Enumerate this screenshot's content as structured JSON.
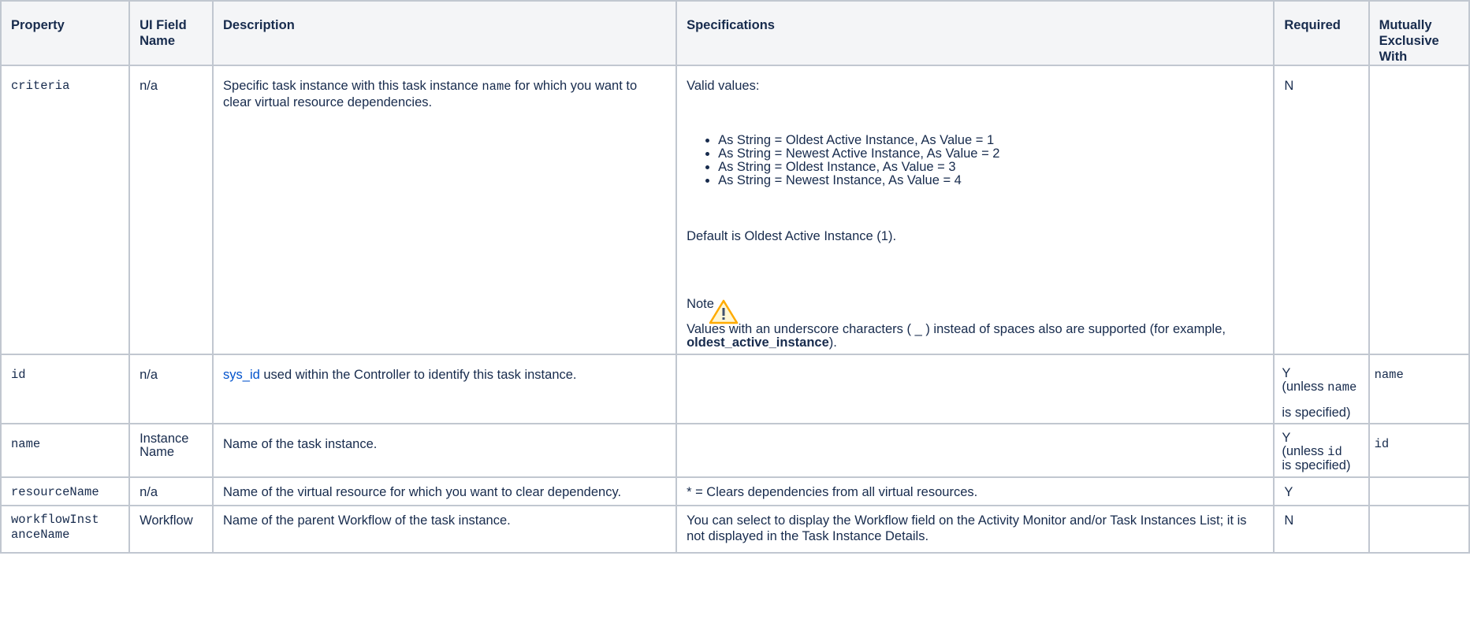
{
  "columns": [
    "Property",
    "UI Field Name",
    "Description",
    "Specifications",
    "Required",
    "Mutually Exclusive With"
  ],
  "rows": [
    {
      "property": "criteria",
      "ui_field": "n/a",
      "description_pre": "Specific task instance with this task instance ",
      "description_code": "name",
      "description_post": " for which you want to clear virtual resource dependencies.",
      "spec_intro": "Valid values:",
      "spec_items": [
        "As String = Oldest Active Instance, As Value = 1",
        "As String = Newest Active Instance, As Value = 2",
        "As String = Oldest Instance, As Value = 3",
        "As String = Newest Instance, As Value = 4"
      ],
      "spec_default": "Default is Oldest Active Instance (1).",
      "note_title": "Note",
      "note_pre": "Values with an underscore characters ( _ ) instead of spaces also are supported (for example, ",
      "note_bold": "oldest_active_instance",
      "note_post": ").",
      "required": "N",
      "exclusive": ""
    },
    {
      "property": "id",
      "ui_field": "n/a",
      "description_link": "sys_id",
      "description_post": " used within the Controller to identify this task instance.",
      "spec": "",
      "required_line1": "Y",
      "required_pre": "(unless ",
      "required_code": "name",
      "required_post": "is specified)",
      "exclusive": "name"
    },
    {
      "property": "name",
      "ui_field": "Instance Name",
      "description": "Name of the task instance.",
      "spec": "",
      "required_line1": "Y",
      "required_pre": "(unless ",
      "required_code": "id",
      "required_post": "is specified)",
      "exclusive": "id"
    },
    {
      "property": "resourceName",
      "ui_field": "n/a",
      "description": "Name of the virtual resource for which you want to clear dependency.",
      "spec": "* = Clears dependencies from all virtual resources.",
      "required": "Y",
      "exclusive": ""
    },
    {
      "property_line1": "workflowInst",
      "property_line2": "anceName",
      "ui_field": "Workflow",
      "description": "Name of the parent Workflow of the task instance.",
      "spec": "You can select to display the Workflow field on the Activity Monitor and/or Task Instances List; it is not displayed in the Task Instance Details.",
      "required": "N",
      "exclusive": ""
    }
  ],
  "icons": {
    "note": "warning-icon"
  },
  "colors": {
    "link": "#0052cc",
    "header_bg": "#f4f5f7",
    "border": "#c1c7d0",
    "warning": "#ffab00"
  }
}
